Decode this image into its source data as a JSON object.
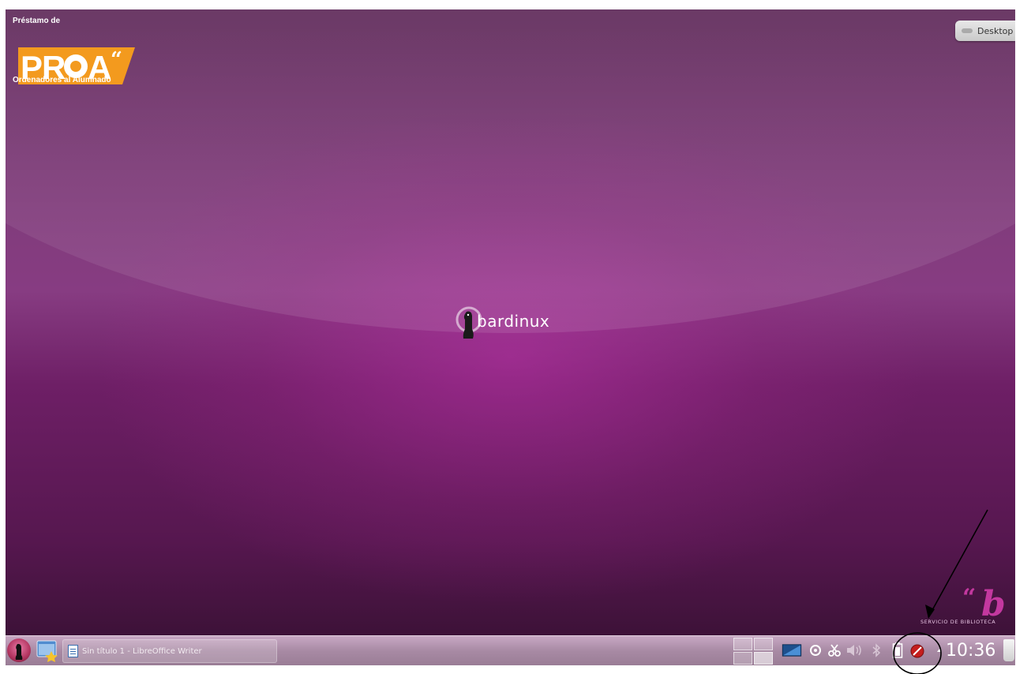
{
  "desktop": {
    "proa_logo": {
      "top_text": "Préstamo de",
      "logo_text": "PROA",
      "bottom_text": "Ordenadores al Alumnado"
    },
    "show_desktop_button": {
      "label": "Desktop"
    },
    "center_logo": {
      "text": "bardinux"
    },
    "library_logo": {
      "text": "servicio de biblioteca"
    }
  },
  "taskbar": {
    "tasks": [
      {
        "label": "Sin título 1 - LibreOffice Writer"
      }
    ],
    "clock": "10:36"
  },
  "colors": {
    "desktop_purple": "#7d3c78",
    "accent_magenta": "#c3389f",
    "proa_orange": "#f39a1e",
    "taskbar": "#a88aa4"
  },
  "icons": [
    "kickoff-launcher-icon",
    "show-desktop-icon",
    "writer-document-icon",
    "pager-icon",
    "monitor-icon",
    "network-icon",
    "klipper-icon",
    "volume-icon",
    "bluetooth-icon",
    "battery-icon",
    "update-notifier-icon",
    "tray-expand-icon",
    "trash-icon"
  ]
}
